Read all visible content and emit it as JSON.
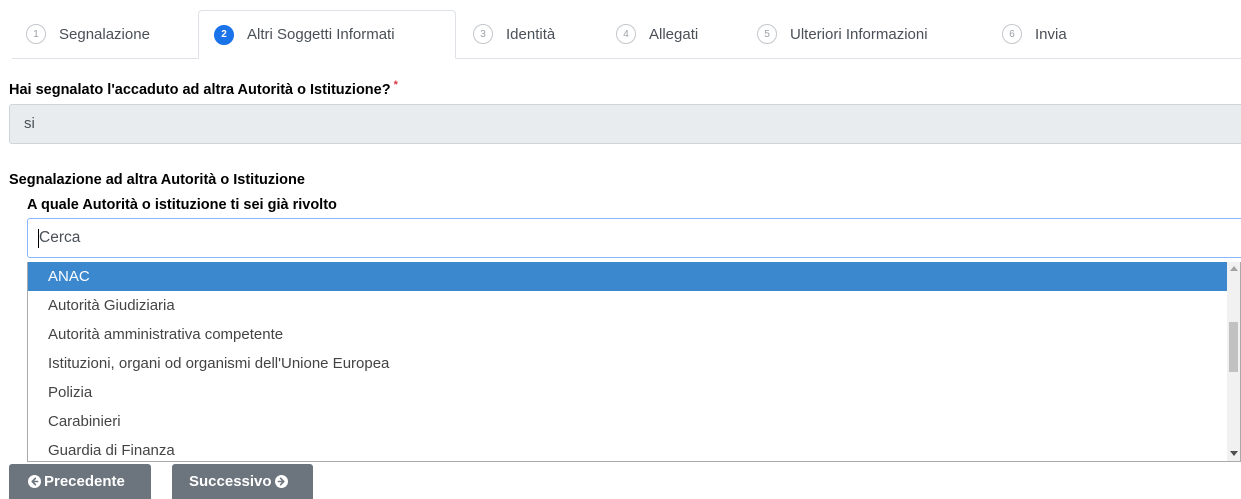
{
  "steps": [
    {
      "number": "1",
      "label": "Segnalazione"
    },
    {
      "number": "2",
      "label": "Altri Soggetti Informati"
    },
    {
      "number": "3",
      "label": "Identità"
    },
    {
      "number": "4",
      "label": "Allegati"
    },
    {
      "number": "5",
      "label": "Ulteriori Informazioni"
    },
    {
      "number": "6",
      "label": "Invia"
    }
  ],
  "question": {
    "label": "Hai segnalato l'accaduto ad altra Autorità o Istituzione?",
    "required_mark": "*",
    "value": "si"
  },
  "section": {
    "title": "Segnalazione ad altra Autorità o Istituzione",
    "field_label": "A quale Autorità o istituzione ti sei già rivolto",
    "search_placeholder": "Cerca",
    "options": [
      "ANAC",
      "Autorità Giudiziaria",
      "Autorità amministrativa competente",
      "Istituzioni, organi od organismi dell'Unione Europea",
      "Polizia",
      "Carabinieri",
      "Guardia di Finanza"
    ],
    "selected_index": 0
  },
  "buttons": {
    "prev_label": "Precedente",
    "next_label": "Successivo"
  },
  "colors": {
    "active_step": "#1a73e8",
    "selected_option": "#3c88ce",
    "button": "#6c757d",
    "required": "#dc3545"
  }
}
